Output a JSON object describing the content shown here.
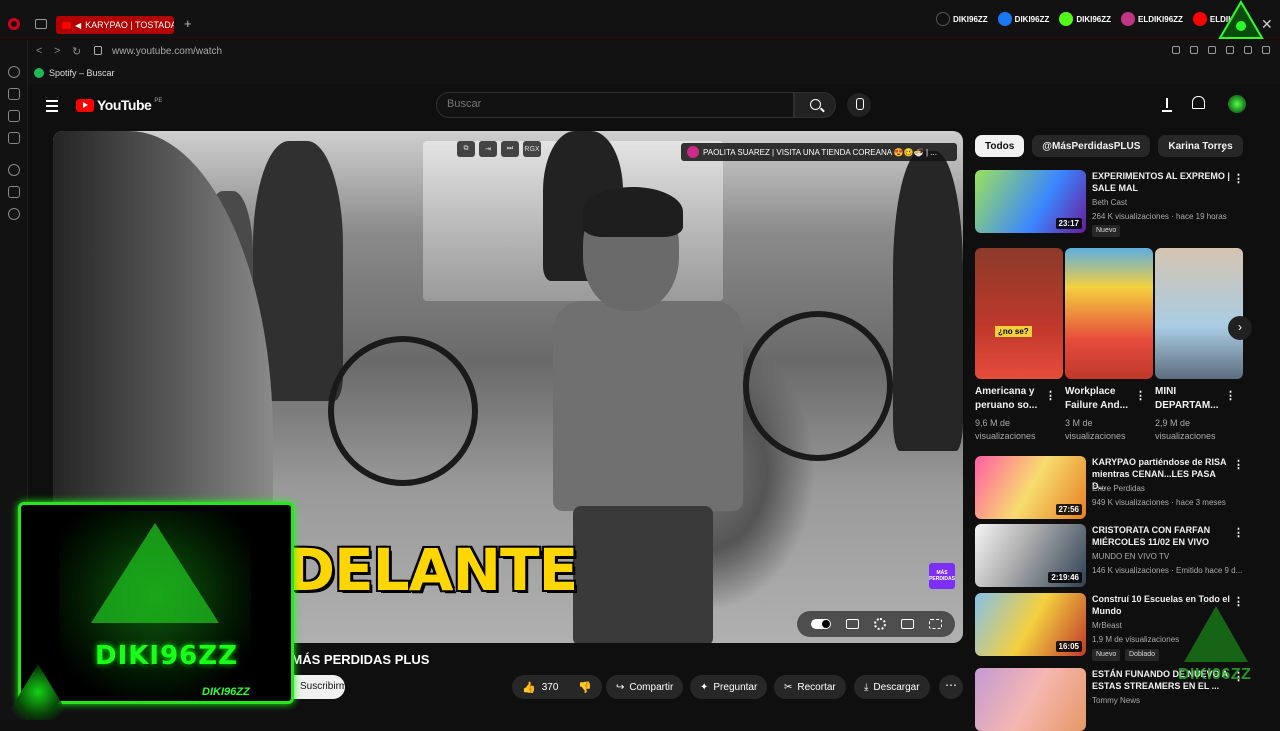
{
  "browser": {
    "active_tab_title": "KARYPAO | TOSTADAS",
    "url": "www.youtube.com/watch",
    "bookmark": "Spotify – Buscar",
    "socials": [
      {
        "label": "DIKI96ZZ",
        "color": "#000000"
      },
      {
        "label": "DIKI96ZZ",
        "color": "#1877f2"
      },
      {
        "label": "DIKI96ZZ",
        "color": "#53fc18"
      },
      {
        "label": "ELDIKI96ZZ",
        "color": "#c13584"
      },
      {
        "label": "ELDIKI",
        "color": "#ff0000"
      }
    ]
  },
  "youtube": {
    "logo_text": "YouTube",
    "country_code": "PE",
    "search_placeholder": "Buscar"
  },
  "video": {
    "notification": "PAOLITA SUAREZ | VISITA UNA TIENDA COREANA 😍🥴🍜 | ...",
    "overlay_label": "RGX",
    "caption": "ADELANTE",
    "brand_badge": "MÁS PERDIDAS",
    "title": "😂👏✨ | MÁS PERDIDAS PLUS",
    "subscribe": "Suscribirme",
    "likes": "370",
    "actions": [
      "Compartir",
      "Preguntar",
      "Recortar",
      "Descargar"
    ]
  },
  "streamer": {
    "name": "DIKI96ZZ",
    "sub": "DIKI96ZZ"
  },
  "chips": [
    "Todos",
    "@MásPerdidasPLUS",
    "Karina Torres"
  ],
  "related": [
    {
      "title": "EXPERIMENTOS AL EXPREMO | SALE MAL",
      "channel": "Beth Cast",
      "meta": "264 K visualizaciones · hace 19 horas",
      "duration": "23:17",
      "badge": "Nuevo"
    },
    {
      "title": "KARYPAO partiéndose de RISA mientras CENAN...LES PASA D...",
      "channel": "Entre Perdidas",
      "meta": "949 K visualizaciones · hace 3 meses",
      "duration": "27:56"
    },
    {
      "title": "CRISTORATA CON FARFAN MIÉRCOLES 11/02 EN VIVO",
      "channel": "MUNDO EN VIVO TV",
      "meta": "146 K visualizaciones · Emitido hace 9 d...",
      "duration": "2:19:46"
    },
    {
      "title": "Construí 10 Escuelas en Todo el Mundo",
      "channel": "MrBeast",
      "meta": "1,9 M de visualizaciones",
      "duration": "16:05",
      "badge": "Nuevo",
      "badge2": "Doblado"
    },
    {
      "title": "ESTÁN FUNANDO DE NUEVO A ESTAS STREAMERS EN EL ...",
      "channel": "Tommy News"
    }
  ],
  "shorts": [
    {
      "title": "Americana y peruano so...",
      "views": "9,6 M de visualizaciones",
      "overlay": "¿no se?"
    },
    {
      "title": "Workplace Failure And...",
      "views": "3 M de visualizaciones"
    },
    {
      "title": "MINI DEPARTAM...",
      "views": "2,9 M de visualizaciones"
    }
  ],
  "watermark": "DIKI96ZZ"
}
